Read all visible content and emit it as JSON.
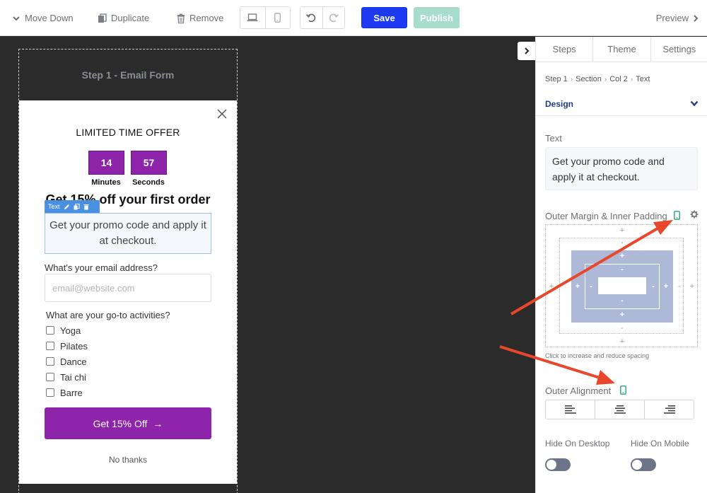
{
  "toolbar": {
    "move_down": "Move Down",
    "duplicate": "Duplicate",
    "remove": "Remove",
    "save": "Save",
    "publish": "Publish",
    "preview": "Preview"
  },
  "canvas": {
    "step_title": "Step 1 - Email Form",
    "popup": {
      "offer_title": "LIMITED TIME OFFER",
      "timer": {
        "minutes_value": "14",
        "minutes_label": "Minutes",
        "seconds_value": "57",
        "seconds_label": "Seconds"
      },
      "headline": "Get 15% off your first order",
      "text_tag": "Text",
      "text_body": "Get your promo code and apply it at checkout.",
      "email_label": "What's your email address?",
      "email_placeholder": "email@website.com",
      "activities_label": "What are your go-to activities?",
      "activities": [
        "Yoga",
        "Pilates",
        "Dance",
        "Tai chi",
        "Barre"
      ],
      "cta": "Get 15% Off",
      "cta_arrow": "→",
      "no_thanks": "No thanks"
    }
  },
  "panel": {
    "tabs": [
      "Steps",
      "Theme",
      "Settings"
    ],
    "breadcrumb": [
      "Step 1",
      "Section",
      "Col 2",
      "Text"
    ],
    "design_label": "Design",
    "text_label": "Text",
    "text_value": "Get your promo code and apply it at checkout.",
    "spacing_label": "Outer Margin & Inner Padding",
    "spacing_hint": "Click to increase and reduce spacing",
    "alignment_label": "Outer Alignment",
    "hide_desktop": "Hide On Desktop",
    "hide_mobile": "Hide On Mobile",
    "hide_desktop_on": false,
    "hide_mobile_on": false
  },
  "colors": {
    "save": "#1d3af2",
    "publish": "#a8dccd",
    "accent_purple": "#8e24aa",
    "annotation_arrow": "#e8472c",
    "padding_fill": "#aeb9d8",
    "mobile_icon": "#27a37c"
  }
}
